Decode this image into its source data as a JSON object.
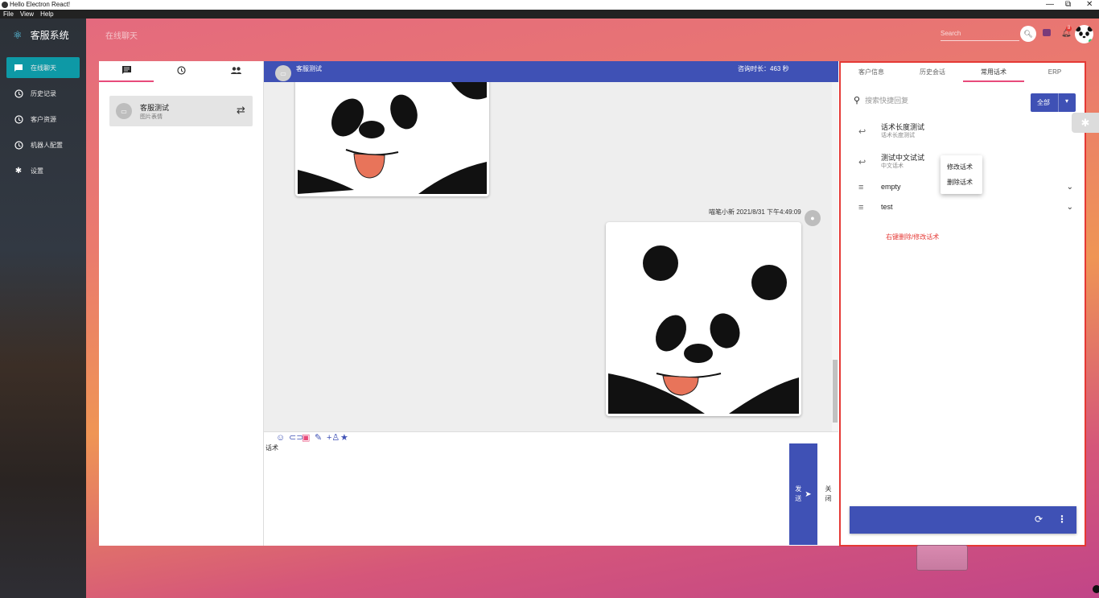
{
  "window": {
    "title": "Hello Electron React!",
    "controls": [
      "—",
      "⧉",
      "✕"
    ]
  },
  "menu": [
    "File",
    "View",
    "Help"
  ],
  "sidebar": {
    "brand": "客服系统",
    "items": [
      {
        "label": "在线聊天",
        "icon": "chat-icon",
        "active": true
      },
      {
        "label": "历史记录",
        "icon": "history-icon",
        "active": false
      },
      {
        "label": "客户资源",
        "icon": "customer-icon",
        "active": false
      },
      {
        "label": "机器人配置",
        "icon": "robot-icon",
        "active": false
      },
      {
        "label": "设置",
        "icon": "gear-icon",
        "active": false
      }
    ]
  },
  "header": {
    "page_title": "在线聊天",
    "search_placeholder": "Search",
    "notification_count": "8"
  },
  "left_panel": {
    "tabs": [
      "chat-list-icon",
      "history-icon",
      "contacts-icon"
    ],
    "session": {
      "name": "客服测试",
      "subtitle": "图片表情"
    }
  },
  "chat": {
    "name": "客服测试",
    "duration": "咨询时长：463 秒",
    "message_meta": "喵笔小新 2021/8/31 下午4:49:09",
    "input_value": "话术",
    "send_label": "发\n送",
    "close_label": "关\n闭",
    "toolbar": [
      "emoji-icon",
      "attach-icon",
      "image-icon",
      "edit-icon",
      "add-user-icon",
      "star-icon"
    ]
  },
  "right_panel": {
    "tabs": [
      "客户信息",
      "历史会话",
      "常用话术",
      "ERP"
    ],
    "active_tab": "常用话术",
    "search_placeholder": "搜索快捷回复",
    "filter_label": "全部",
    "replies": [
      {
        "title": "话术长度测试",
        "subtitle": "话术长度测试",
        "icon": "reply-icon"
      },
      {
        "title": "测试中文试试",
        "subtitle": "中文话术",
        "icon": "reply-icon"
      },
      {
        "title": "empty",
        "subtitle": "",
        "icon": "list-icon"
      },
      {
        "title": "test",
        "subtitle": "",
        "icon": "list-icon"
      }
    ],
    "context_menu": [
      "修改话术",
      "删除话术"
    ],
    "hint": "右键删除/修改话术"
  },
  "colors": {
    "primary": "#3f51b5",
    "accent": "#e84a7a",
    "active_nav": "#0e99a6",
    "hint": "#e53935"
  }
}
